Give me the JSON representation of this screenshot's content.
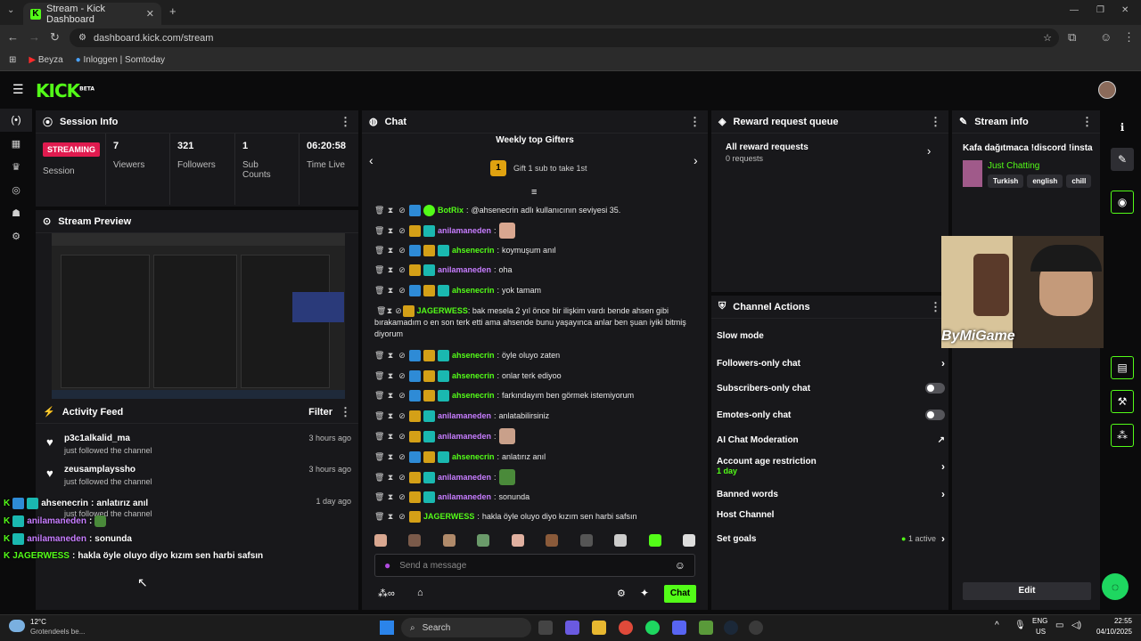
{
  "browser": {
    "tab_title": "Stream - Kick Dashboard",
    "url": "dashboard.kick.com/stream",
    "bookmarks": [
      "Beyza",
      "Inloggen | Somtoday"
    ]
  },
  "header": {
    "logo": "KICK",
    "logo_sup": "BETA"
  },
  "session": {
    "title": "Session Info",
    "status": "STREAMING",
    "status_label": "Session",
    "stats": [
      {
        "value": "7",
        "label": "Viewers"
      },
      {
        "value": "321",
        "label": "Followers"
      },
      {
        "value": "1",
        "label": "Sub Counts"
      },
      {
        "value": "06:20:58",
        "label": "Time Live"
      }
    ]
  },
  "preview": {
    "title": "Stream Preview"
  },
  "activity": {
    "title": "Activity Feed",
    "filter": "Filter",
    "items": [
      {
        "user": "p3c1alkalid_ma",
        "action": "just followed the channel",
        "time": "3 hours ago"
      },
      {
        "user": "zeusamplayssho",
        "action": "just followed the channel",
        "time": "3 hours ago"
      },
      {
        "user": "",
        "action": "just followed the channel",
        "time": "1 day ago"
      }
    ]
  },
  "chat": {
    "title": "Chat",
    "gifters_title": "Weekly top Gifters",
    "gifters_rank": "1",
    "gifters_cta": "Gift 1 sub to take 1st",
    "messages": [
      {
        "user": "BotRix",
        "color": "#53fc18",
        "text": "@ahsenecrin adlı kullanıcının seviyesi 35."
      },
      {
        "user": "anilamaneden",
        "color": "#c77dff",
        "text": ""
      },
      {
        "user": "ahsenecrin",
        "color": "#53fc18",
        "text": "koymuşum anıl"
      },
      {
        "user": "anilamaneden",
        "color": "#c77dff",
        "text": "oha"
      },
      {
        "user": "ahsenecrin",
        "color": "#53fc18",
        "text": "yok tamam"
      },
      {
        "user": "JAGERWESS",
        "color": "#53fc18",
        "text": "bak mesela 2 yıl önce bir ilişkim vardı bende ahsen gibi bırakamadım o en son terk etti ama ahsende bunu yaşayınca anlar ben şuan iyiki bitmiş diyorum"
      },
      {
        "user": "ahsenecrin",
        "color": "#53fc18",
        "text": "öyle oluyo zaten"
      },
      {
        "user": "ahsenecrin",
        "color": "#53fc18",
        "text": "onlar terk ediyoo"
      },
      {
        "user": "ahsenecrin",
        "color": "#53fc18",
        "text": "farkındayım ben görmek istemiyorum"
      },
      {
        "user": "anilamaneden",
        "color": "#c77dff",
        "text": "anlatabilirsiniz"
      },
      {
        "user": "anilamaneden",
        "color": "#c77dff",
        "text": ""
      },
      {
        "user": "ahsenecrin",
        "color": "#53fc18",
        "text": "anlatırız anıl"
      },
      {
        "user": "anilamaneden",
        "color": "#c77dff",
        "text": ""
      },
      {
        "user": "anilamaneden",
        "color": "#c77dff",
        "text": "sonunda"
      },
      {
        "user": "JAGERWESS",
        "color": "#53fc18",
        "text": "hakla öyle oluyo diyo kızım sen harbi safsın"
      }
    ],
    "input_placeholder": "Send a message",
    "send_label": "Chat"
  },
  "rewards": {
    "title": "Reward request queue",
    "all_label": "All reward requests",
    "count": "0 requests"
  },
  "channel_actions": {
    "title": "Channel Actions",
    "rows": [
      {
        "label": "Slow mode",
        "control": "none"
      },
      {
        "label": "Followers-only chat",
        "control": "chevron"
      },
      {
        "label": "Subscribers-only chat",
        "control": "toggle"
      },
      {
        "label": "Emotes-only chat",
        "control": "toggle"
      },
      {
        "label": "AI Chat Moderation",
        "control": "external"
      },
      {
        "label": "Account age restriction",
        "sub": "1 day",
        "control": "chevron"
      },
      {
        "label": "Banned words",
        "control": "chevron"
      },
      {
        "label": "Host Channel",
        "control": "none"
      },
      {
        "label": "Set goals",
        "status": "1 active",
        "control": "chevron"
      }
    ]
  },
  "stream_info": {
    "title": "Stream info",
    "stream_title": "Kafa dağıtmaca !discord !insta",
    "category": "Just Chatting",
    "tags": [
      "Turkish",
      "english",
      "chill"
    ],
    "edit_label": "Edit"
  },
  "webcam": {
    "watermark": "ByMiGame"
  },
  "overlay_chat": [
    {
      "user": "ahsenecrin",
      "text": "anlatırız anıl"
    },
    {
      "user": "anilamaneden",
      "text": ""
    },
    {
      "user": "anilamaneden",
      "text": "sonunda"
    },
    {
      "user": "JAGERWESS",
      "text": "hakla öyle oluyo diyo kızım sen harbi safsın"
    }
  ],
  "taskbar": {
    "weather_temp": "12°C",
    "weather_desc": "Grotendeels be...",
    "search": "Search",
    "lang": "ENG",
    "region": "US",
    "time": "22:55",
    "date": "04/10/2025"
  },
  "colors": {
    "accent": "#53fc18",
    "panel": "#18181b",
    "streaming": "#e01b4f"
  }
}
